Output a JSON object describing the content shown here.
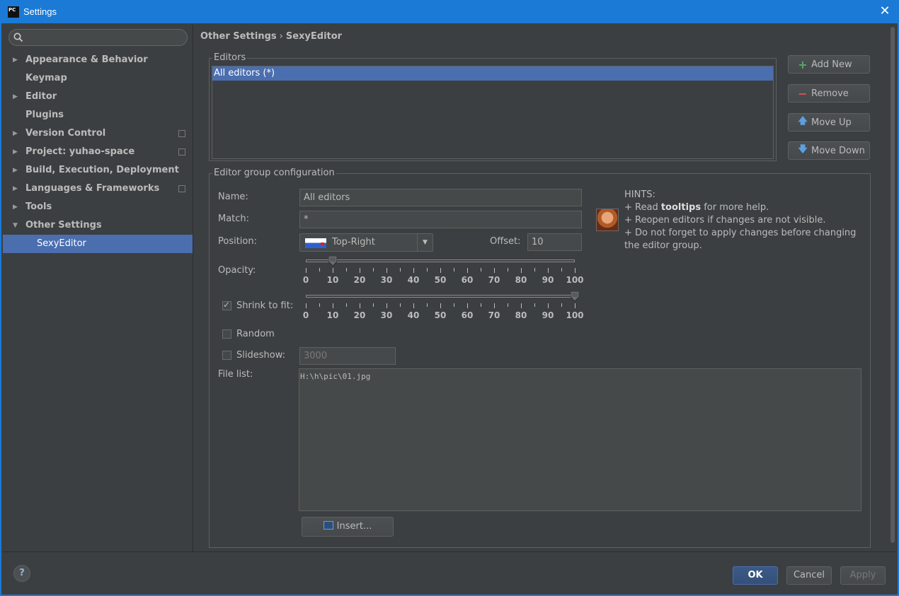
{
  "window": {
    "title": "Settings",
    "app_icon": "PC"
  },
  "sidebar": {
    "search_placeholder": "",
    "items": [
      {
        "label": "Appearance & Behavior",
        "expandable": true,
        "expanded": false
      },
      {
        "label": "Keymap",
        "expandable": false
      },
      {
        "label": "Editor",
        "expandable": true,
        "expanded": false
      },
      {
        "label": "Plugins",
        "expandable": false
      },
      {
        "label": "Version Control",
        "expandable": true,
        "expanded": false,
        "project_icon": true
      },
      {
        "label": "Project: yuhao-space",
        "expandable": true,
        "expanded": false,
        "project_icon": true
      },
      {
        "label": "Build, Execution, Deployment",
        "expandable": true,
        "expanded": false
      },
      {
        "label": "Languages & Frameworks",
        "expandable": true,
        "expanded": false,
        "project_icon": true
      },
      {
        "label": "Tools",
        "expandable": true,
        "expanded": false
      },
      {
        "label": "Other Settings",
        "expandable": true,
        "expanded": true
      },
      {
        "label": "SexyEditor",
        "child": true,
        "selected": true
      }
    ]
  },
  "breadcrumb": {
    "parent": "Other Settings",
    "separator": "›",
    "current": "SexyEditor"
  },
  "editors": {
    "legend": "Editors",
    "items": [
      "All editors (*)"
    ],
    "selected_index": 0,
    "buttons": {
      "add": "Add New",
      "remove": "Remove",
      "move_up": "Move Up",
      "move_down": "Move Down"
    }
  },
  "config": {
    "legend": "Editor group configuration",
    "name_label": "Name:",
    "name_value": "All editors",
    "match_label": "Match:",
    "match_value": "*",
    "position_label": "Position:",
    "position_value": "Top-Right",
    "offset_label": "Offset:",
    "offset_value": "10",
    "opacity_label": "Opacity:",
    "opacity_value": 10,
    "shrink_label": "Shrink to fit:",
    "shrink_checked": true,
    "shrink_value": 100,
    "slider_ticks": [
      "0",
      "10",
      "20",
      "30",
      "40",
      "50",
      "60",
      "70",
      "80",
      "90",
      "100"
    ],
    "random_label": "Random",
    "random_checked": false,
    "slideshow_label": "Slideshow:",
    "slideshow_checked": false,
    "slideshow_value": "3000",
    "file_list_label": "File list:",
    "file_list_value": "H:\\h\\pic\\01.jpg",
    "insert_label": "Insert..."
  },
  "hints": {
    "title": "HINTS:",
    "line1_prefix": "+ Read ",
    "line1_bold": "tooltips",
    "line1_suffix": " for more help.",
    "line2": "+ Reopen editors if changes are not visible.",
    "line3": "+ Do not forget to apply changes before changing the editor group."
  },
  "footer": {
    "help": "?",
    "ok": "OK",
    "cancel": "Cancel",
    "apply": "Apply"
  },
  "colors": {
    "titlebar": "#1b7ad6",
    "selection": "#4b6eaf",
    "background": "#3c3f41"
  }
}
